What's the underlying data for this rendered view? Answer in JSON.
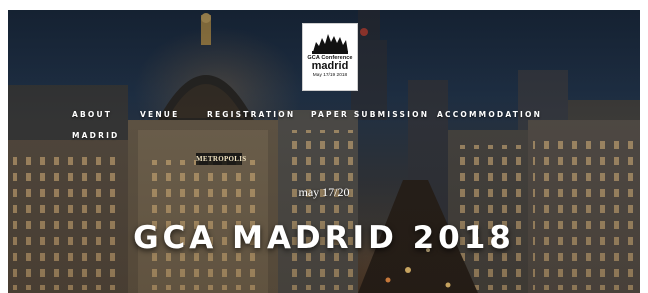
{
  "logo": {
    "line1": "GCA Conference",
    "line2": "madrid",
    "line3": "May 17/19 2018"
  },
  "nav": {
    "about": "ABOUT",
    "venue": "VENUE",
    "registration": "REGISTRATION",
    "paper_submission": "PAPER SUBMISSION",
    "accommodation": "ACCOMMODATION",
    "madrid": "MADRID"
  },
  "scene": {
    "sign": "METROPOLIS"
  },
  "hero": {
    "date": "may 17/20",
    "title": "GCA MADRID 2018"
  }
}
